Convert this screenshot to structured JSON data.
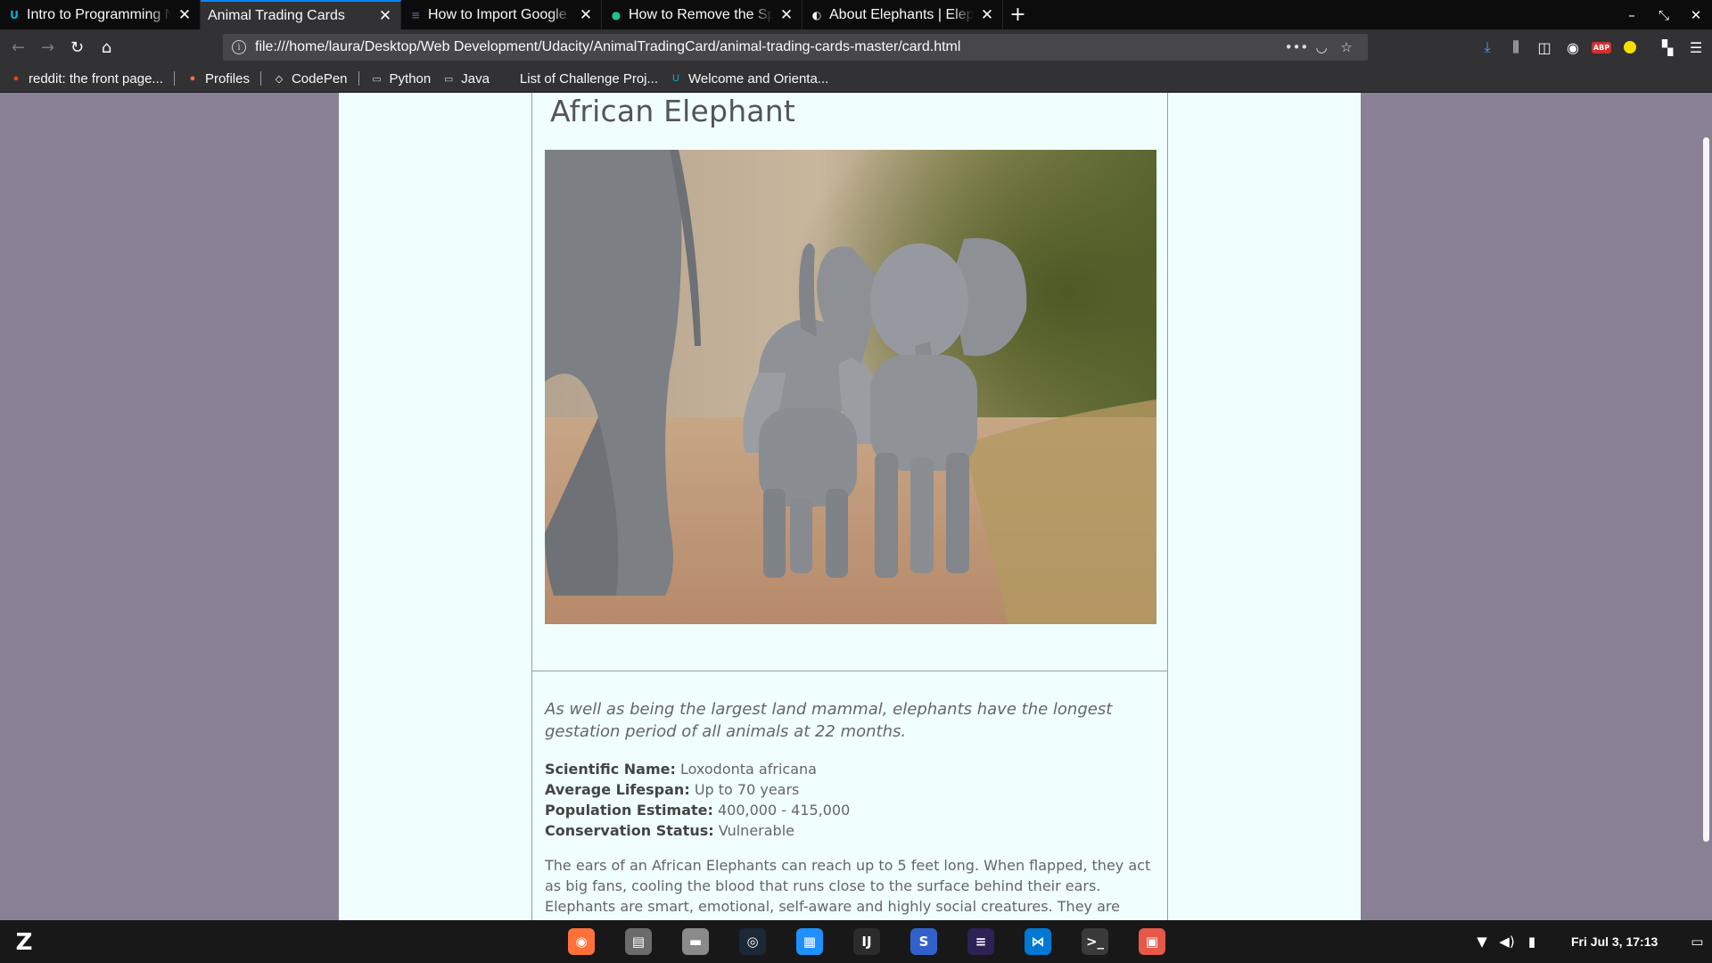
{
  "browser": {
    "tabs": [
      {
        "title": "Intro to Programming N",
        "active": false,
        "icon": "udacity-icon",
        "color": "#02b3e4",
        "glyph": "U"
      },
      {
        "title": "Animal Trading Cards",
        "active": true,
        "icon": "none",
        "color": "",
        "glyph": ""
      },
      {
        "title": "How to Import Google F",
        "active": false,
        "icon": "page-icon",
        "color": "#555a7a",
        "glyph": "≡"
      },
      {
        "title": "How to Remove the Spa",
        "active": false,
        "icon": "shield-icon",
        "color": "#1ec38a",
        "glyph": "●"
      },
      {
        "title": "About Elephants | Eleph",
        "active": false,
        "icon": "globe-icon",
        "color": "#ffffff",
        "glyph": "◐"
      }
    ],
    "url": "file:///home/laura/Desktop/Web Development/Udacity/AnimalTradingCard/animal-trading-cards-master/card.html",
    "bookmarks": [
      {
        "label": "reddit: the front page...",
        "icon": "reddit-icon",
        "color": "#ff4500",
        "glyph": "●"
      },
      {
        "label": "Profiles",
        "icon": "firefox-icon",
        "color": "#ff7139",
        "glyph": "●"
      },
      {
        "label": "CodePen",
        "icon": "codepen-icon",
        "color": "#ffffff",
        "glyph": "◇"
      },
      {
        "label": "Python",
        "icon": "folder-icon",
        "color": "#d0d0d0",
        "glyph": "▭"
      },
      {
        "label": "Java",
        "icon": "folder-icon",
        "color": "#d0d0d0",
        "glyph": "▭"
      },
      {
        "label": "List of Challenge Proj...",
        "icon": "blank-page-icon",
        "color": "#323234",
        "glyph": ""
      },
      {
        "label": "Welcome and Orienta...",
        "icon": "udacity-icon",
        "color": "#02b3e4",
        "glyph": "U"
      }
    ]
  },
  "card": {
    "name": "African Elephant",
    "fact": "As well as being the largest land mammal, elephants have the longest gestation period of all animals at 22 months.",
    "stats": [
      {
        "label": "Scientific Name:",
        "value": "Loxodonta africana"
      },
      {
        "label": "Average Lifespan:",
        "value": "Up to 70 years"
      },
      {
        "label": "Population Estimate:",
        "value": "400,000 - 415,000"
      },
      {
        "label": "Conservation Status:",
        "value": "Vulnerable"
      }
    ],
    "description": "The ears of an African Elephants can reach up to 5 feet long. When flapped, they act as big fans, cooling the blood that runs close to the surface behind their ears. Elephants are smart, emotional, self-aware and highly social creatures. They are herbivores, eating a diet of"
  },
  "taskbar": {
    "apps": [
      {
        "name": "firefox-app",
        "color": "#ff7139",
        "glyph": "◉",
        "running": false
      },
      {
        "name": "archive-app",
        "color": "#6b6b6b",
        "glyph": "▤",
        "running": false
      },
      {
        "name": "files-app",
        "color": "#8a8a8a",
        "glyph": "▬",
        "running": false
      },
      {
        "name": "steam-app",
        "color": "#1b2838",
        "glyph": "◎",
        "running": false
      },
      {
        "name": "store-app",
        "color": "#1e90ff",
        "glyph": "▦",
        "running": false
      },
      {
        "name": "intellij-app",
        "color": "#2b2b2b",
        "glyph": "IJ",
        "running": false
      },
      {
        "name": "simplenote-app",
        "color": "#3361cc",
        "glyph": "S",
        "running": false
      },
      {
        "name": "eclipse-app",
        "color": "#2c2255",
        "glyph": "≡",
        "running": false
      },
      {
        "name": "vscode-app",
        "color": "#0078d4",
        "glyph": "⋈",
        "running": false
      },
      {
        "name": "terminal-app",
        "color": "#3a3a3a",
        "glyph": ">_",
        "running": false
      },
      {
        "name": "screenshot-app",
        "color": "#e5584a",
        "glyph": "▣",
        "running": false
      }
    ],
    "clock": "Fri Jul  3, 17:13"
  }
}
